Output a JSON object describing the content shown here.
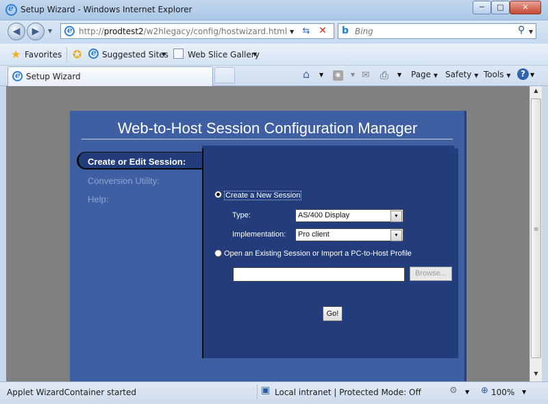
{
  "window": {
    "title": "Setup Wizard - Windows Internet Explorer",
    "minimize": "─",
    "maximize": "□",
    "close": "✕"
  },
  "address": {
    "url_prefix": "http://",
    "url_host": "prodtest2",
    "url_path": "/w2hlegacy/config/hostwizard.html",
    "search_placeholder": "Bing"
  },
  "favorites": {
    "label": "Favorites",
    "suggested": "Suggested Sites",
    "slice": "Web Slice Gallery"
  },
  "tab": {
    "label": "Setup Wizard"
  },
  "commandbar": {
    "page": "Page",
    "safety": "Safety",
    "tools": "Tools"
  },
  "applet": {
    "title": "Web-to-Host Session Configuration Manager",
    "nav": {
      "create": "Create or Edit Session:",
      "convert": "Conversion Utility:",
      "help": "Help:"
    },
    "create_new_label": "Create a New Session",
    "type_label": "Type:",
    "type_value": "AS/400 Display",
    "impl_label": "Implementation:",
    "impl_value": "Pro client",
    "open_label": "Open an Existing Session or Import a PC-to-Host Profile",
    "path_value": "",
    "browse_label": "Browse...",
    "go_label": "Go!"
  },
  "status": {
    "text": "Applet WizardContainer started",
    "zone": "Local intranet | Protected Mode: Off",
    "zoom": "100%"
  },
  "colors": {
    "applet_bg": "#3f5fa3",
    "panel_bg": "#233c7c",
    "viewport_bg": "#808080"
  }
}
